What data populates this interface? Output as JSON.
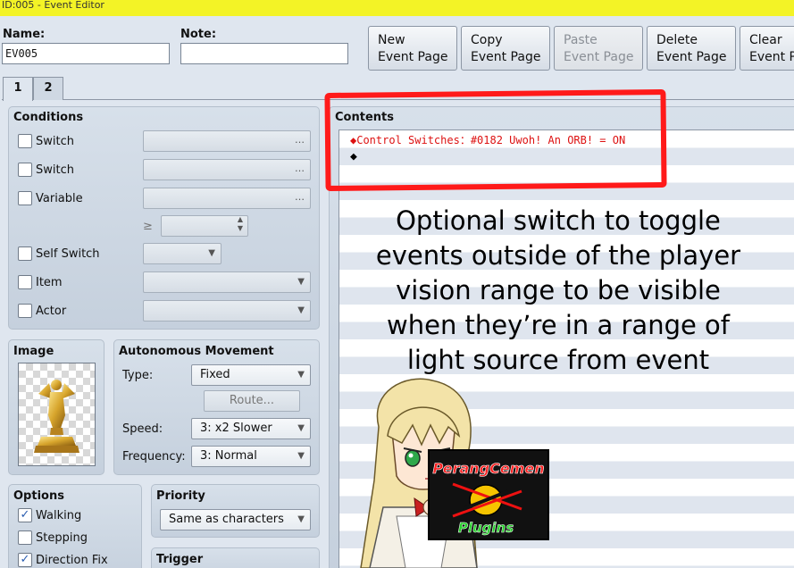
{
  "window": {
    "title": "ID:005 - Event Editor"
  },
  "fields": {
    "name_label": "Name:",
    "name_value": "EV005",
    "note_label": "Note:",
    "note_value": ""
  },
  "toolbar": [
    {
      "line1": "New",
      "line2": "Event Page",
      "disabled": false
    },
    {
      "line1": "Copy",
      "line2": "Event Page",
      "disabled": false
    },
    {
      "line1": "Paste",
      "line2": "Event Page",
      "disabled": true
    },
    {
      "line1": "Delete",
      "line2": "Event Page",
      "disabled": false
    },
    {
      "line1": "Clear",
      "line2": "Event Page",
      "disabled": false
    }
  ],
  "tabs": [
    "1",
    "2"
  ],
  "conditions": {
    "title": "Conditions",
    "switch1_label": "Switch",
    "switch2_label": "Switch",
    "variable_label": "Variable",
    "ge_symbol": "≥",
    "self_switch_label": "Self Switch",
    "item_label": "Item",
    "actor_label": "Actor",
    "dots": "…"
  },
  "image": {
    "title": "Image",
    "icon": "golden-statue-icon"
  },
  "autonomous": {
    "title": "Autonomous Movement",
    "type_label": "Type:",
    "type_value": "Fixed",
    "route_button": "Route...",
    "speed_label": "Speed:",
    "speed_value": "3: x2 Slower",
    "frequency_label": "Frequency:",
    "frequency_value": "3: Normal"
  },
  "options": {
    "title": "Options",
    "walking_label": "Walking",
    "walking_checked": true,
    "stepping_label": "Stepping",
    "stepping_checked": false,
    "direction_fix_label": "Direction Fix",
    "direction_fix_checked": true
  },
  "priority": {
    "title": "Priority",
    "value": "Same as characters"
  },
  "trigger": {
    "title": "Trigger"
  },
  "contents": {
    "title": "Contents",
    "commands": [
      "◆Control Switches：#0182 Uwoh! An ORB! = ON",
      "◆"
    ]
  },
  "annotation": {
    "lines": [
      "Optional switch to toggle",
      "events outside of the player",
      "vision range to be visible",
      "when they’re in a range of",
      "light source from event"
    ],
    "highlight_color": "#ff1a1a"
  },
  "mascot": {
    "sign_line1": "PerangCemen",
    "sign_line2": "Plugins"
  },
  "colors": {
    "titlebar": "#f3f326",
    "command_text": "#dd1111",
    "panel": "#dfe6ef"
  }
}
